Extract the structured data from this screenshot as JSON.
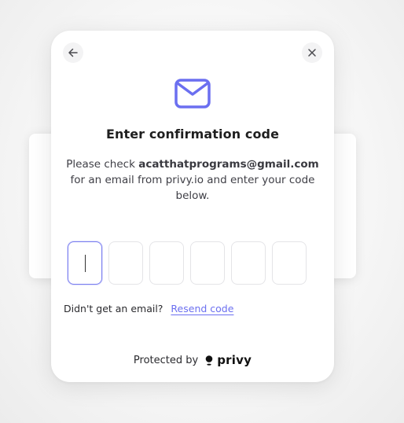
{
  "modal": {
    "title": "Enter confirmation code",
    "description": {
      "prefix": "Please check",
      "email": "acatthatprograms@gmail.com",
      "suffix": "for an email from privy.io and enter your code below."
    },
    "code_boxes": [
      "",
      "",
      "",
      "",
      "",
      ""
    ],
    "active_box_index": 0,
    "resend_prompt": "Didn't get an email?",
    "resend_link": "Resend code",
    "footer_label": "Protected by",
    "brand_name": "privy"
  },
  "icons": {
    "back": "arrow-left-icon",
    "close": "close-icon",
    "mail": "envelope-icon",
    "brand": "privy-logo-icon"
  },
  "colors": {
    "accent": "#6b6ff0",
    "active_border": "#7b7ff0",
    "text_primary": "#1f1f1f"
  }
}
